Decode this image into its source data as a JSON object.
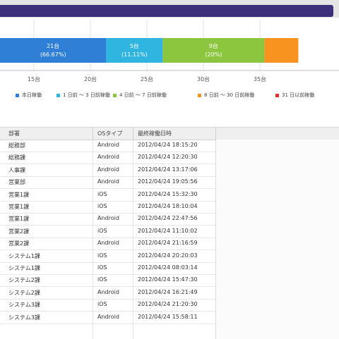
{
  "chart_data": {
    "type": "bar",
    "orientation": "horizontal-stacked",
    "x_ticks": [
      "15台",
      "20台",
      "25台",
      "30台",
      "35台"
    ],
    "segments": [
      {
        "name": "本日稼働",
        "value": 21,
        "label": "21台",
        "percent": "(66.67%)",
        "color": "#2f7fd6"
      },
      {
        "name": "1 日前 ～ 3 日前稼働",
        "value": 5,
        "label": "5台",
        "percent": "(11.11%)",
        "color": "#2fb5e0"
      },
      {
        "name": "4 日前 ～ 7 日前稼働",
        "value": 9,
        "label": "9台",
        "percent": "(20%)",
        "color": "#8cc63f"
      },
      {
        "name": "8 日前 ～ 30 日前稼働",
        "value": 3,
        "label": "",
        "percent": "",
        "color": "#f7931e"
      },
      {
        "name": "31 日以前稼働",
        "value": 0,
        "label": "",
        "percent": "",
        "color": "#e03030"
      }
    ],
    "xlim": [
      12,
      42
    ],
    "grid": true,
    "legend": "bottom"
  },
  "table": {
    "headers": [
      "部署",
      "OSタイプ",
      "最終稼働日時"
    ],
    "rows": [
      [
        "総務部",
        "Android",
        "2012/04/24 18:15:20"
      ],
      [
        "総務課",
        "Android",
        "2012/04/24 12:20:30"
      ],
      [
        "人事課",
        "Android",
        "2012/04/24 13:17:06"
      ],
      [
        "営業部",
        "Android",
        "2012/04/24 19:05:56"
      ],
      [
        "営業1課",
        "iOS",
        "2012/04/24 15:32:30"
      ],
      [
        "営業1課",
        "iOS",
        "2012/04/24 18:10:04"
      ],
      [
        "営業1課",
        "Android",
        "2012/04/24 22:47:56"
      ],
      [
        "営業2課",
        "iOS",
        "2012/04/24 11:10:02"
      ],
      [
        "営業2課",
        "Android",
        "2012/04/24 21:16:59"
      ],
      [
        "システム1課",
        "iOS",
        "2012/04/24 20:20:03"
      ],
      [
        "システム1課",
        "iOS",
        "2012/04/24 08:03:14"
      ],
      [
        "システム2課",
        "iOS",
        "2012/04/24 15:47:30"
      ],
      [
        "システム2課",
        "Android",
        "2012/04/24 16:21:49"
      ],
      [
        "システム3課",
        "iOS",
        "2012/04/24 21:20:30"
      ],
      [
        "システム3課",
        "Android",
        "2012/04/24 15:58:11"
      ]
    ]
  }
}
